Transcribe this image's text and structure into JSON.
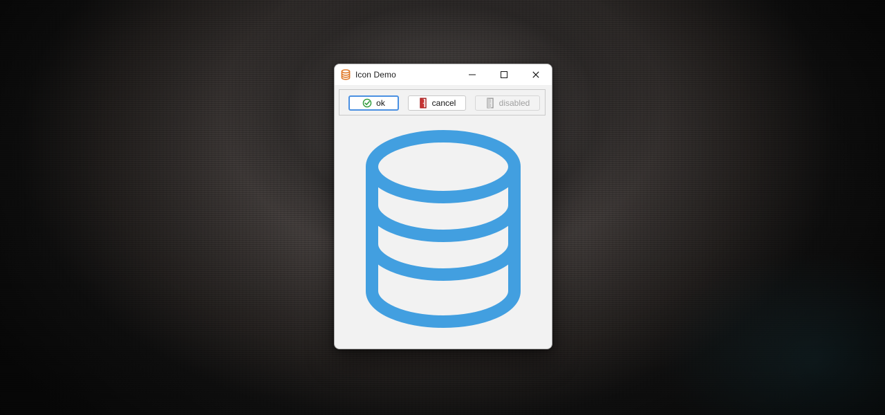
{
  "window": {
    "title": "Icon Demo",
    "app_icon": "database-icon",
    "caption_buttons": [
      "minimize",
      "maximize",
      "close"
    ]
  },
  "toolbar": {
    "buttons": [
      {
        "label": "ok",
        "icon": "check-circle-icon",
        "state": "focused"
      },
      {
        "label": "cancel",
        "icon": "door-icon",
        "state": "normal"
      },
      {
        "label": "disabled",
        "icon": "door-icon",
        "state": "disabled"
      }
    ]
  },
  "content": {
    "icon": "database-icon",
    "icon_color": "#429fe0"
  },
  "colors": {
    "accent": "#429fe0",
    "ok_check": "#2e9a3a",
    "cancel_door": "#a01919",
    "disabled": "#a0a0a0",
    "app_icon_color": "#e07a2a"
  }
}
